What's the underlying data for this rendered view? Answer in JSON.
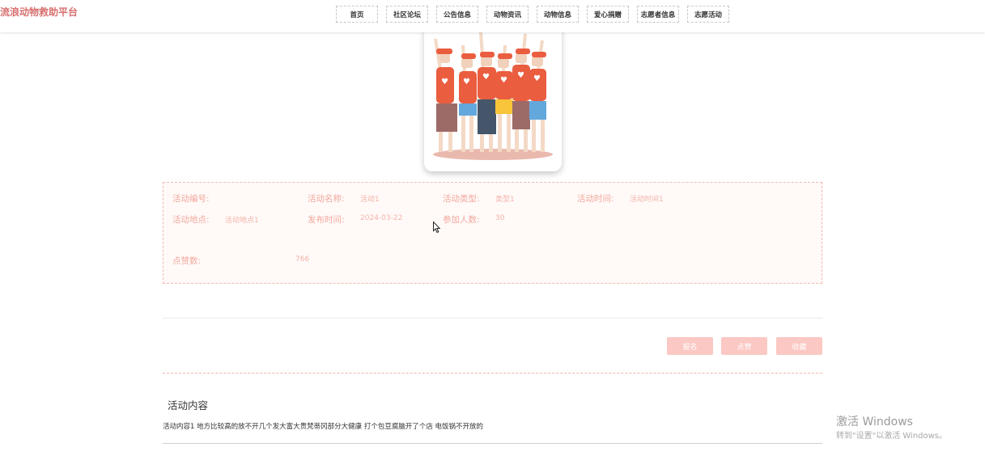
{
  "header": {
    "site_title": "流浪动物救助平台",
    "nav": [
      "首页",
      "社区论坛",
      "公告信息",
      "动物资讯",
      "动物信息",
      "爱心捐赠",
      "志愿者信息",
      "志愿活动"
    ]
  },
  "cover": {
    "icon": "volunteers-group-illustration"
  },
  "details": {
    "id_label": "活动编号:",
    "id_value": "",
    "name_label": "活动名称:",
    "name_value": "活动1",
    "type_label": "活动类型:",
    "type_value": "类型1",
    "time_label": "活动时间:",
    "time_value": "活动时间1",
    "place_label": "活动地点:",
    "place_value": "活动地点1",
    "publish_label": "发布时间:",
    "publish_value": "2024-03-22",
    "count_label": "参加人数:",
    "count_value": "30",
    "likes_label": "点赞数:",
    "likes_value": "766"
  },
  "actions": {
    "signup": "报名",
    "like": "点赞",
    "favorite": "收藏"
  },
  "content": {
    "title": "活动内容",
    "text": "活动内容1 地方比较高的放不开几个发大富大贵梵蒂冈部分大健康 打个包豆腐脑开了个店 电饭锅不开放的"
  },
  "windows_watermark": {
    "line1": "激活 Windows",
    "line2": "转到\"设置\"以激活 Windows。"
  },
  "colors": {
    "accent": "#d86f6f",
    "button": "#fbc8c3",
    "label": "#f2a89e"
  }
}
